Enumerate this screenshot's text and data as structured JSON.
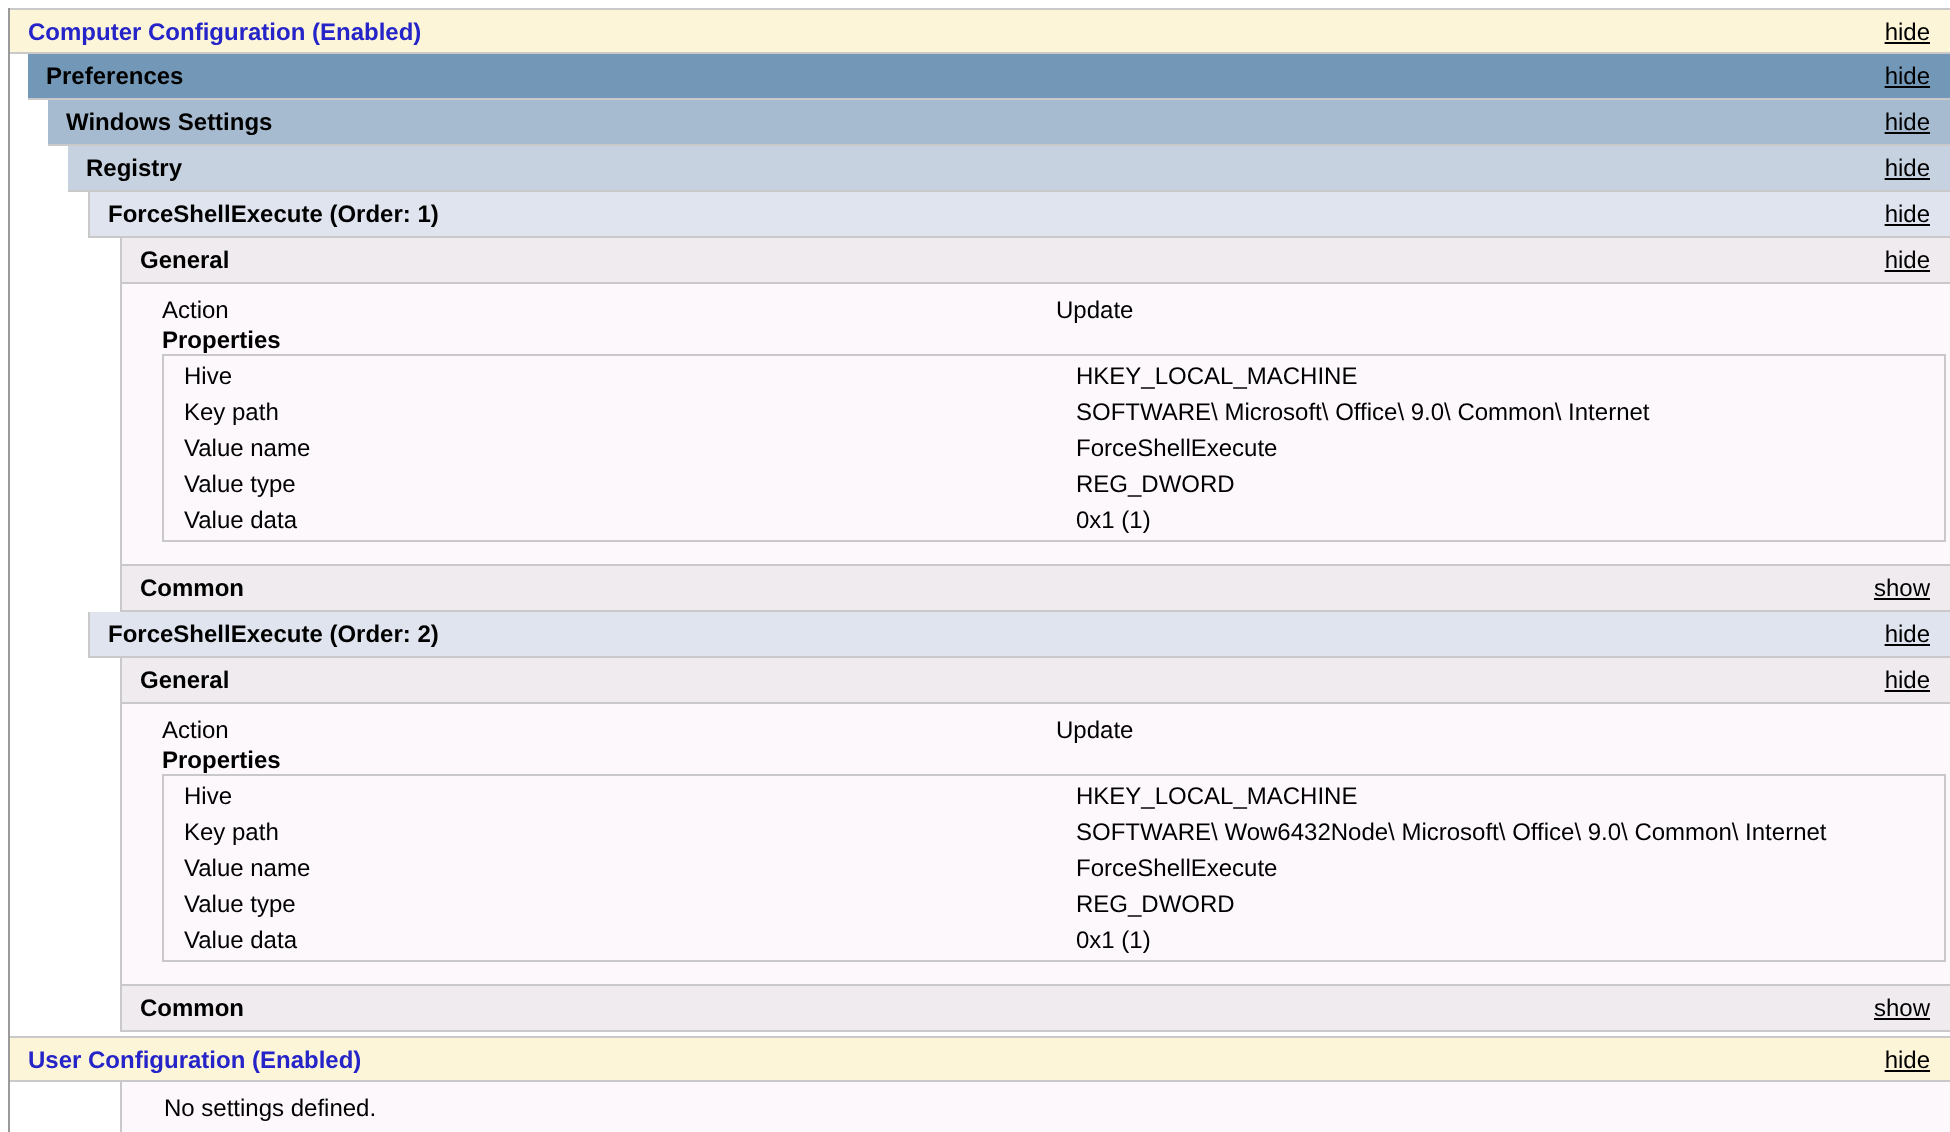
{
  "computer_config": {
    "title": "Computer Configuration (Enabled)",
    "toggle": "hide",
    "preferences": {
      "title": "Preferences",
      "toggle": "hide",
      "windows_settings": {
        "title": "Windows Settings",
        "toggle": "hide",
        "registry": {
          "title": "Registry",
          "toggle": "hide",
          "items": [
            {
              "title": "ForceShellExecute (Order: 1)",
              "toggle": "hide",
              "general": {
                "title": "General",
                "toggle": "hide",
                "action_label": "Action",
                "action_value": "Update",
                "properties_label": "Properties",
                "properties": [
                  {
                    "name": "Hive",
                    "value": "HKEY_LOCAL_MACHINE"
                  },
                  {
                    "name": "Key path",
                    "value": "SOFTWARE\\ Microsoft\\ Office\\ 9.0\\ Common\\ Internet"
                  },
                  {
                    "name": "Value name",
                    "value": "ForceShellExecute"
                  },
                  {
                    "name": "Value type",
                    "value": "REG_DWORD"
                  },
                  {
                    "name": "Value data",
                    "value": "0x1 (1)"
                  }
                ]
              },
              "common": {
                "title": "Common",
                "toggle": "show"
              }
            },
            {
              "title": "ForceShellExecute (Order: 2)",
              "toggle": "hide",
              "general": {
                "title": "General",
                "toggle": "hide",
                "action_label": "Action",
                "action_value": "Update",
                "properties_label": "Properties",
                "properties": [
                  {
                    "name": "Hive",
                    "value": "HKEY_LOCAL_MACHINE"
                  },
                  {
                    "name": "Key path",
                    "value": "SOFTWARE\\ Wow6432Node\\ Microsoft\\ Office\\ 9.0\\ Common\\ Internet"
                  },
                  {
                    "name": "Value name",
                    "value": "ForceShellExecute"
                  },
                  {
                    "name": "Value type",
                    "value": "REG_DWORD"
                  },
                  {
                    "name": "Value data",
                    "value": "0x1 (1)"
                  }
                ]
              },
              "common": {
                "title": "Common",
                "toggle": "show"
              }
            }
          ]
        }
      }
    }
  },
  "user_config": {
    "title": "User Configuration (Enabled)",
    "toggle": "hide",
    "message": "No settings defined."
  }
}
